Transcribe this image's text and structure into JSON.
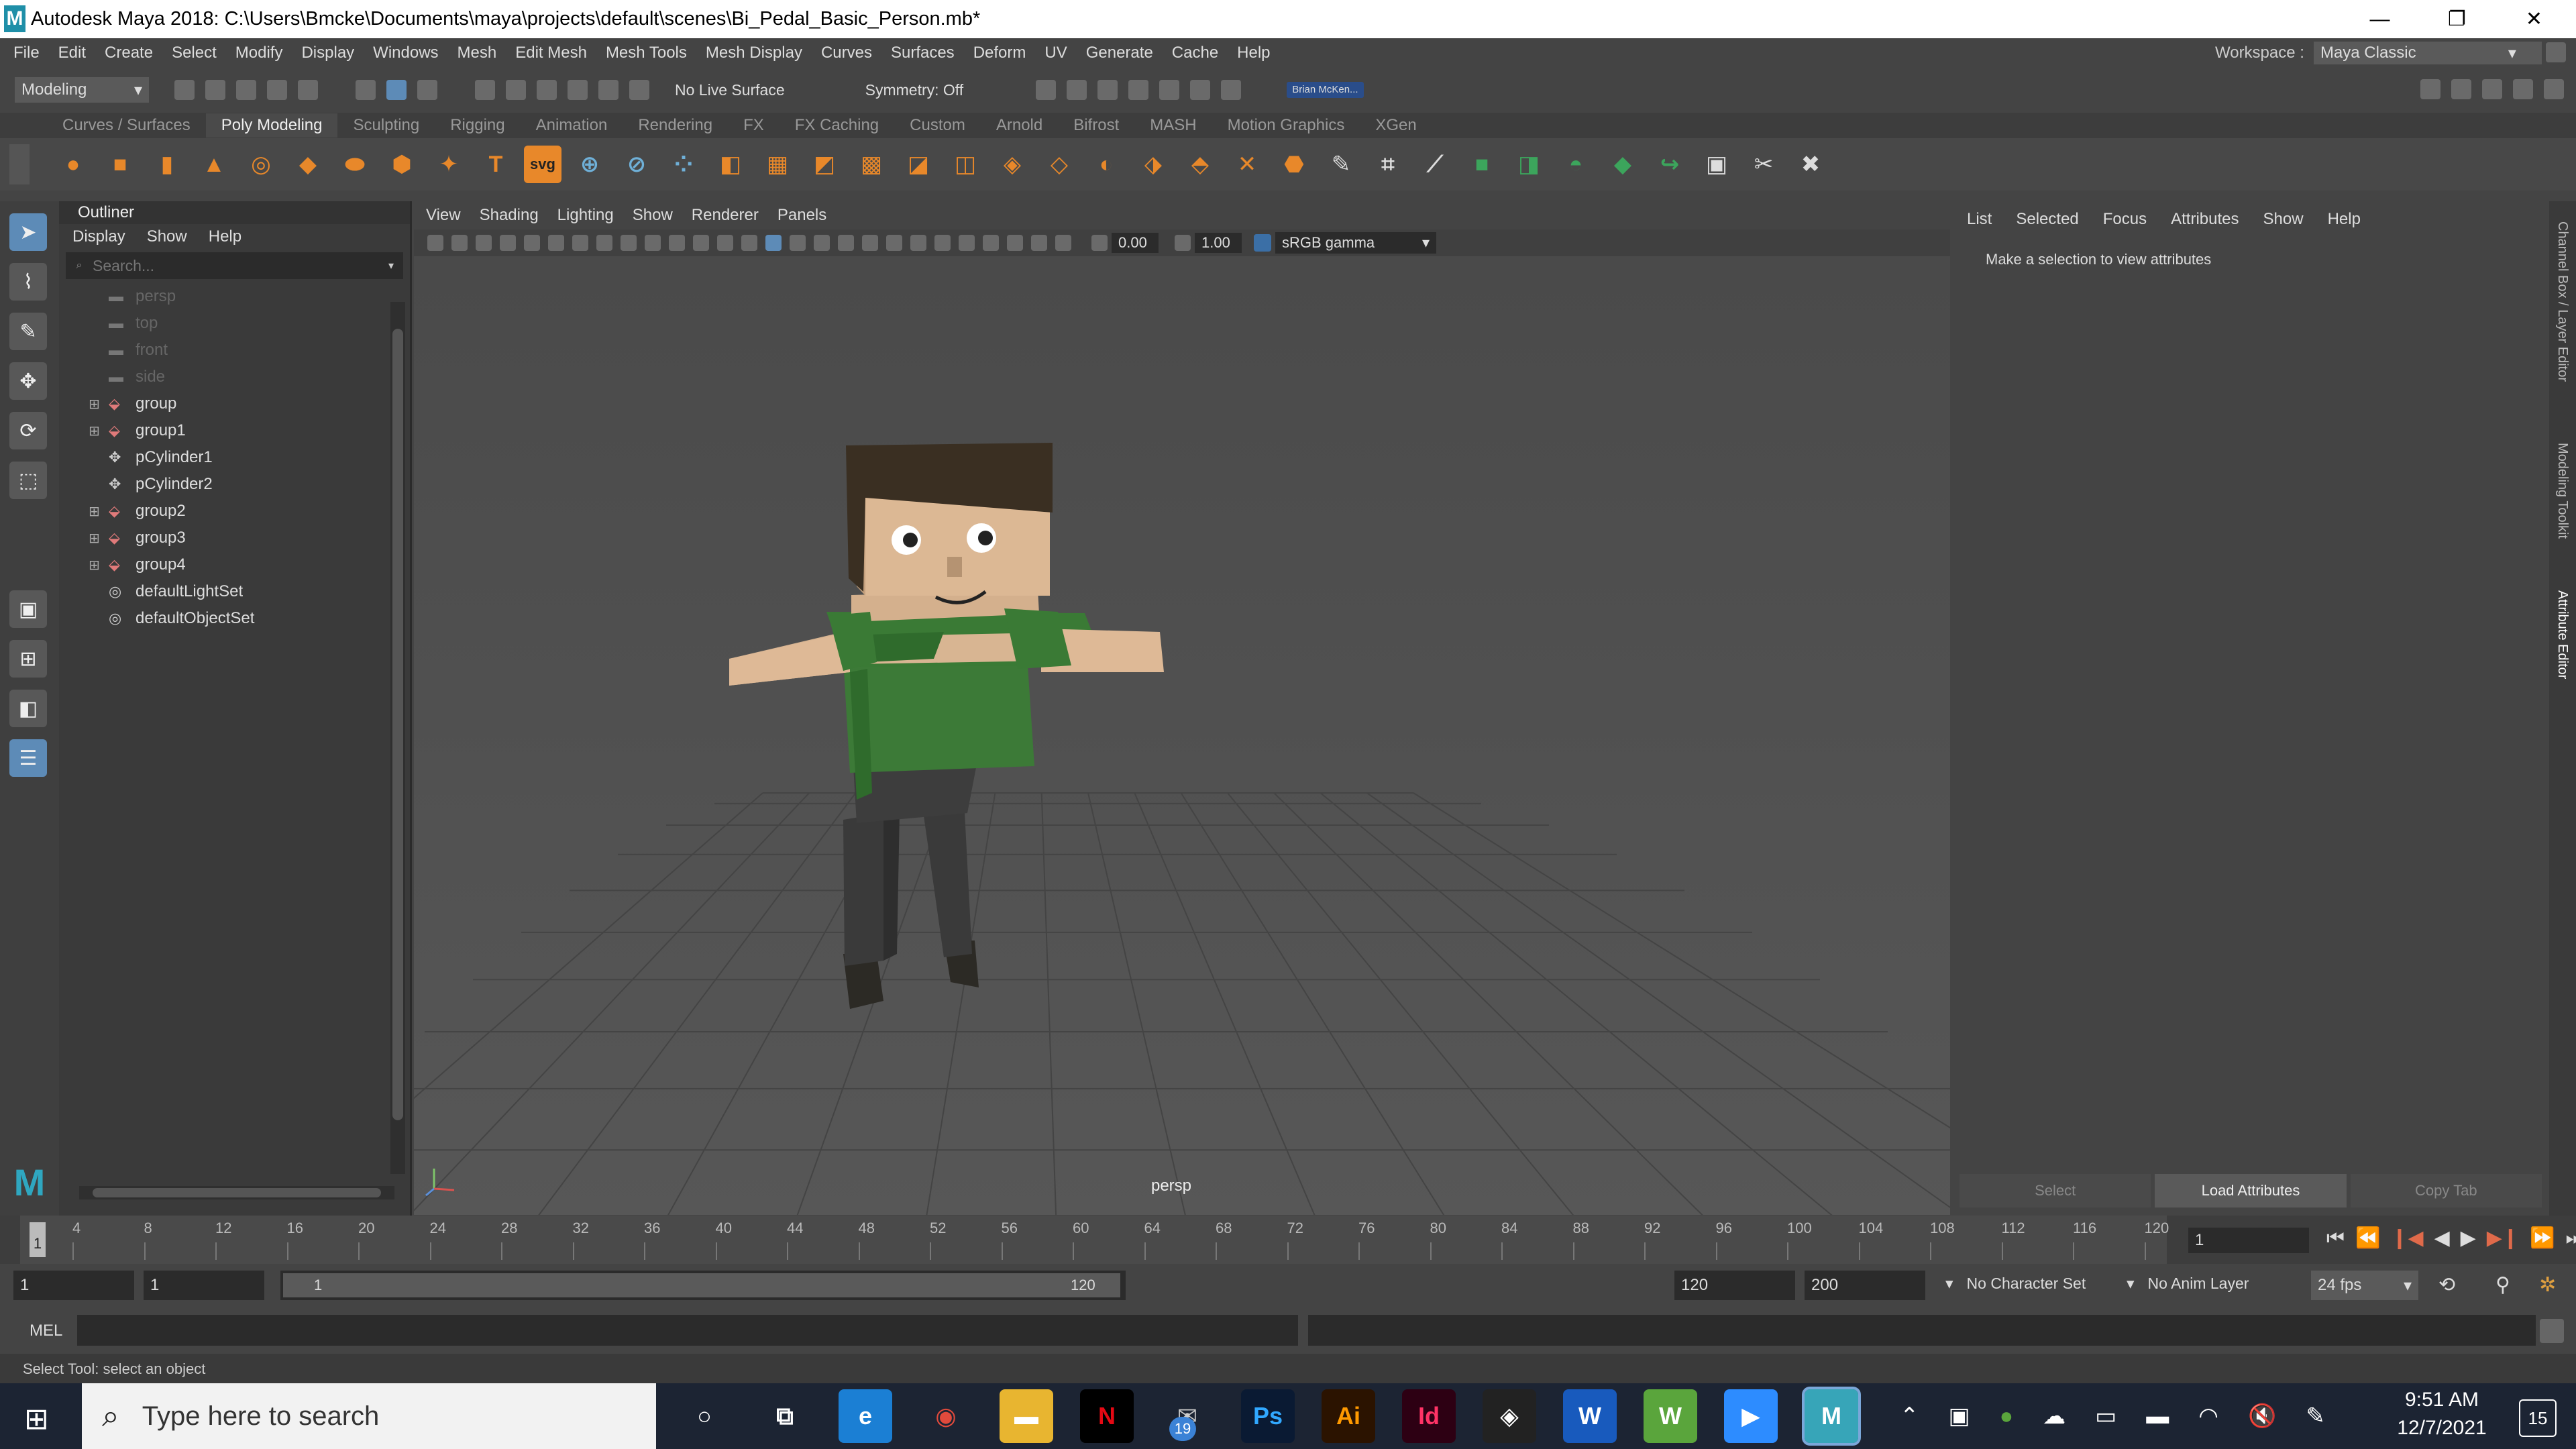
{
  "window": {
    "title": "Autodesk Maya 2018: C:\\Users\\Bmcke\\Documents\\maya\\projects\\default\\scenes\\Bi_Pedal_Basic_Person.mb*",
    "app_icon": "M"
  },
  "menubar": {
    "items": [
      "File",
      "Edit",
      "Create",
      "Select",
      "Modify",
      "Display",
      "Windows",
      "Mesh",
      "Edit Mesh",
      "Mesh Tools",
      "Mesh Display",
      "Curves",
      "Surfaces",
      "Deform",
      "UV",
      "Generate",
      "Cache",
      "Help"
    ],
    "workspace_label": "Workspace :",
    "workspace_value": "Maya Classic"
  },
  "status_line": {
    "mode": "Modeling",
    "live_surface": "No Live Surface",
    "symmetry": "Symmetry: Off",
    "user": "Brian McKen..."
  },
  "shelf_tabs": [
    "Curves / Surfaces",
    "Poly Modeling",
    "Sculpting",
    "Rigging",
    "Animation",
    "Rendering",
    "FX",
    "FX Caching",
    "Custom",
    "Arnold",
    "Bifrost",
    "MASH",
    "Motion Graphics",
    "XGen"
  ],
  "shelf_active": "Poly Modeling",
  "shelf_icons": [
    {
      "name": "sphere-icon",
      "glyph": "●",
      "color": "#e8882a"
    },
    {
      "name": "cube-icon",
      "glyph": "■",
      "color": "#e8882a"
    },
    {
      "name": "cylinder-icon",
      "glyph": "▮",
      "color": "#e8882a"
    },
    {
      "name": "cone-icon",
      "glyph": "▲",
      "color": "#e8882a"
    },
    {
      "name": "torus-icon",
      "glyph": "◎",
      "color": "#e8882a"
    },
    {
      "name": "plane-icon",
      "glyph": "◆",
      "color": "#e8882a"
    },
    {
      "name": "disc-icon",
      "glyph": "⬬",
      "color": "#e8882a"
    },
    {
      "name": "platonic-icon",
      "glyph": "⬢",
      "color": "#e8882a"
    },
    {
      "name": "superellipse-icon",
      "glyph": "✦",
      "color": "#e8882a"
    },
    {
      "name": "type-icon",
      "glyph": "T",
      "color": "#e8882a"
    },
    {
      "name": "svg-icon",
      "glyph": "svg",
      "color": "#e8882a"
    },
    {
      "name": "combine-icon",
      "glyph": "⊕",
      "color": "#6fb0d8"
    },
    {
      "name": "separate-icon",
      "glyph": "⊘",
      "color": "#6fb0d8"
    },
    {
      "name": "smooth-icon",
      "glyph": "⁘",
      "color": "#6fb0d8"
    },
    {
      "name": "extrude-icon",
      "glyph": "◧",
      "color": "#e8882a"
    },
    {
      "name": "bridge-icon",
      "glyph": "▦",
      "color": "#e8882a"
    },
    {
      "name": "bevel-icon",
      "glyph": "◩",
      "color": "#e8882a"
    },
    {
      "name": "poke-icon",
      "glyph": "▩",
      "color": "#e8882a"
    },
    {
      "name": "wedge-icon",
      "glyph": "◪",
      "color": "#e8882a"
    },
    {
      "name": "boolean-icon",
      "glyph": "◫",
      "color": "#e8882a"
    },
    {
      "name": "fill-hole-icon",
      "glyph": "◈",
      "color": "#e8882a"
    },
    {
      "name": "append-icon",
      "glyph": "◇",
      "color": "#e8882a"
    },
    {
      "name": "mirror-icon",
      "glyph": "◐",
      "color": "#e8882a"
    },
    {
      "name": "merge-icon",
      "glyph": "⬗",
      "color": "#e8882a"
    },
    {
      "name": "collapse-icon",
      "glyph": "⬘",
      "color": "#e8882a"
    },
    {
      "name": "reduce-icon",
      "glyph": "✕",
      "color": "#e8882a"
    },
    {
      "name": "triangulate-icon",
      "glyph": "⬣",
      "color": "#e8882a"
    },
    {
      "name": "multicut-icon",
      "glyph": "✎",
      "color": "#dddddd"
    },
    {
      "name": "target-weld-icon",
      "glyph": "⌗",
      "color": "#dddddd"
    },
    {
      "name": "connect-icon",
      "glyph": "⟋",
      "color": "#dddddd"
    },
    {
      "name": "uv-planar-icon",
      "glyph": "■",
      "color": "#3ca55c"
    },
    {
      "name": "uv-cylindrical-icon",
      "glyph": "◨",
      "color": "#3ca55c"
    },
    {
      "name": "uv-spherical-icon",
      "glyph": "◓",
      "color": "#3ca55c"
    },
    {
      "name": "uv-auto-icon",
      "glyph": "◆",
      "color": "#3ca55c"
    },
    {
      "name": "uv-transfer-icon",
      "glyph": "↪",
      "color": "#3ca55c"
    },
    {
      "name": "uv-editor-icon",
      "glyph": "▣",
      "color": "#dddddd"
    },
    {
      "name": "uv-cut-icon",
      "glyph": "✂",
      "color": "#dddddd"
    },
    {
      "name": "uv-unfold-icon",
      "glyph": "✖",
      "color": "#dddddd"
    }
  ],
  "outliner": {
    "title": "Outliner",
    "menu": [
      "Display",
      "Show",
      "Help"
    ],
    "search_placeholder": "Search...",
    "items": [
      {
        "label": "persp",
        "dim": true,
        "kind": "camera",
        "expand": false
      },
      {
        "label": "top",
        "dim": true,
        "kind": "camera",
        "expand": false
      },
      {
        "label": "front",
        "dim": true,
        "kind": "camera",
        "expand": false
      },
      {
        "label": "side",
        "dim": true,
        "kind": "camera",
        "expand": false
      },
      {
        "label": "group",
        "dim": false,
        "kind": "group",
        "expand": true
      },
      {
        "label": "group1",
        "dim": false,
        "kind": "group",
        "expand": true
      },
      {
        "label": "pCylinder1",
        "dim": false,
        "kind": "mesh",
        "expand": false
      },
      {
        "label": "pCylinder2",
        "dim": false,
        "kind": "mesh",
        "expand": false
      },
      {
        "label": "group2",
        "dim": false,
        "kind": "group",
        "expand": true
      },
      {
        "label": "group3",
        "dim": false,
        "kind": "group",
        "expand": true
      },
      {
        "label": "group4",
        "dim": false,
        "kind": "group",
        "expand": true
      },
      {
        "label": "defaultLightSet",
        "dim": false,
        "kind": "set",
        "expand": false
      },
      {
        "label": "defaultObjectSet",
        "dim": false,
        "kind": "set",
        "expand": false
      }
    ]
  },
  "viewport": {
    "menu": [
      "View",
      "Shading",
      "Lighting",
      "Show",
      "Renderer",
      "Panels"
    ],
    "exposure": "0.00",
    "gamma": "1.00",
    "color_space": "sRGB gamma",
    "camera_label": "persp"
  },
  "attribute_editor": {
    "menu": [
      "List",
      "Selected",
      "Focus",
      "Attributes",
      "Show",
      "Help"
    ],
    "message": "Make a selection to view attributes",
    "buttons": [
      "Select",
      "Load Attributes",
      "Copy Tab"
    ],
    "side_tabs": [
      "Channel Box / Layer Editor",
      "Modeling Toolkit",
      "Attribute Editor"
    ]
  },
  "timeline": {
    "ticks": [
      "4",
      "8",
      "12",
      "16",
      "20",
      "24",
      "28",
      "32",
      "36",
      "40",
      "44",
      "48",
      "52",
      "56",
      "60",
      "64",
      "68",
      "72",
      "76",
      "80",
      "84",
      "88",
      "92",
      "96",
      "100",
      "104",
      "108",
      "112",
      "116",
      "120"
    ],
    "first_tick": "1",
    "current_frame": "1"
  },
  "range": {
    "start": "1",
    "anim_start": "1",
    "slider_start": "1",
    "slider_end": "120",
    "end": "120",
    "anim_end": "200",
    "character_set": "No Character Set",
    "anim_layer": "No Anim Layer",
    "fps": "24 fps"
  },
  "command_line": {
    "label": "MEL"
  },
  "help_line": "Select Tool: select an object",
  "taskbar": {
    "search_placeholder": "Type here to search",
    "time": "9:51 AM",
    "date": "12/7/2021",
    "notification_count": "15",
    "mail_badge": "19",
    "apps": [
      {
        "name": "cortana-icon",
        "glyph": "○",
        "bg": "transparent",
        "fg": "#ffffff"
      },
      {
        "name": "task-view-icon",
        "glyph": "⧉",
        "bg": "transparent",
        "fg": "#ffffff"
      },
      {
        "name": "edge-icon",
        "glyph": "e",
        "bg": "#1b7fd4",
        "fg": "#ffffff"
      },
      {
        "name": "chrome-icon",
        "glyph": "◉",
        "bg": "transparent",
        "fg": "#e04a3c"
      },
      {
        "name": "explorer-icon",
        "glyph": "▬",
        "bg": "#e8b530",
        "fg": "#ffffff"
      },
      {
        "name": "netflix-icon",
        "glyph": "N",
        "bg": "#000000",
        "fg": "#e50914"
      },
      {
        "name": "mail-icon",
        "glyph": "✉",
        "bg": "transparent",
        "fg": "#cccccc"
      },
      {
        "name": "photoshop-icon",
        "glyph": "Ps",
        "bg": "#0a1a33",
        "fg": "#31a8ff"
      },
      {
        "name": "illustrator-icon",
        "glyph": "Ai",
        "bg": "#2b1300",
        "fg": "#ff9a00"
      },
      {
        "name": "indesign-icon",
        "glyph": "Id",
        "bg": "#2d0013",
        "fg": "#ff3366"
      },
      {
        "name": "unity-icon",
        "glyph": "◈",
        "bg": "#222222",
        "fg": "#ffffff"
      },
      {
        "name": "word-icon",
        "glyph": "W",
        "bg": "#185abd",
        "fg": "#ffffff"
      },
      {
        "name": "webex-icon",
        "glyph": "W",
        "bg": "#5aa53c",
        "fg": "#ffffff"
      },
      {
        "name": "zoom-icon",
        "glyph": "▶",
        "bg": "#2d8cff",
        "fg": "#ffffff"
      },
      {
        "name": "maya-icon",
        "glyph": "M",
        "bg": "#37a5b8",
        "fg": "#ffffff"
      }
    ]
  }
}
